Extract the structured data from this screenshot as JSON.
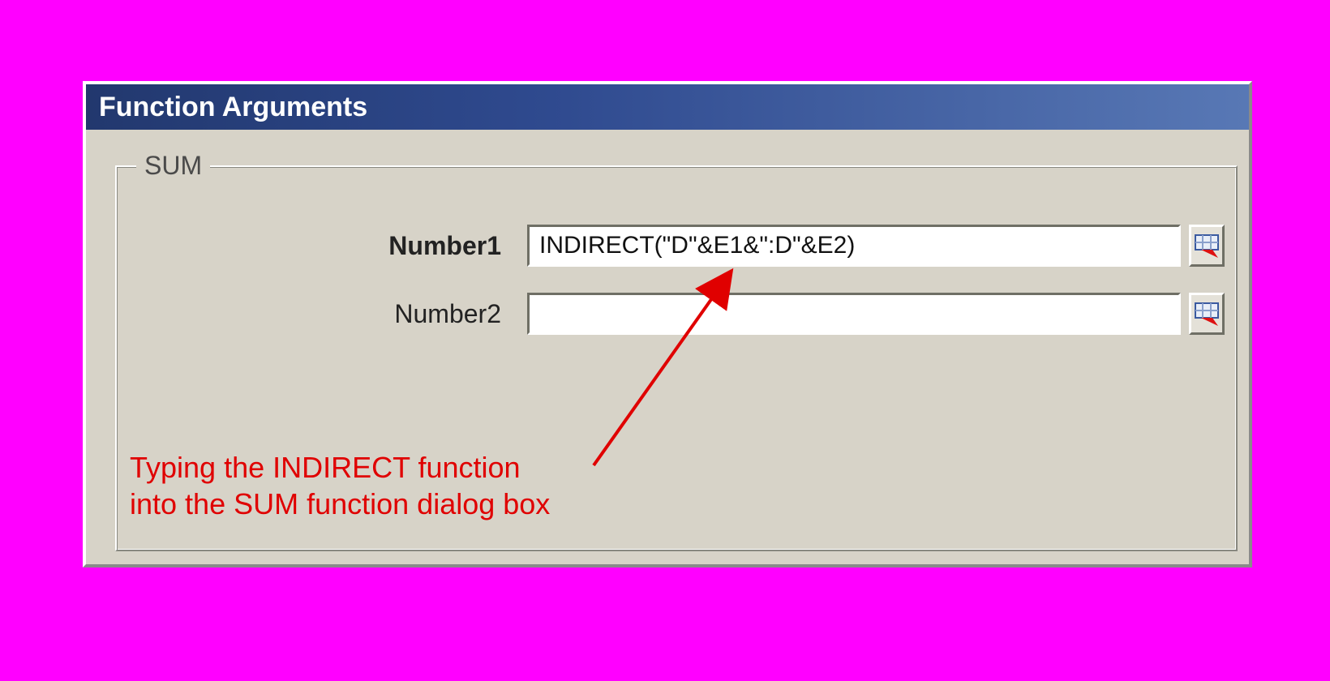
{
  "dialog": {
    "title": "Function Arguments",
    "function_name": "SUM",
    "args": [
      {
        "label": "Number1",
        "required": true,
        "value": "INDIRECT(\"D\"&E1&\":D\"&E2)"
      },
      {
        "label": "Number2",
        "required": false,
        "value": ""
      }
    ]
  },
  "annotation": {
    "line1": "Typing the INDIRECT function",
    "line2": "into the SUM function dialog box"
  }
}
